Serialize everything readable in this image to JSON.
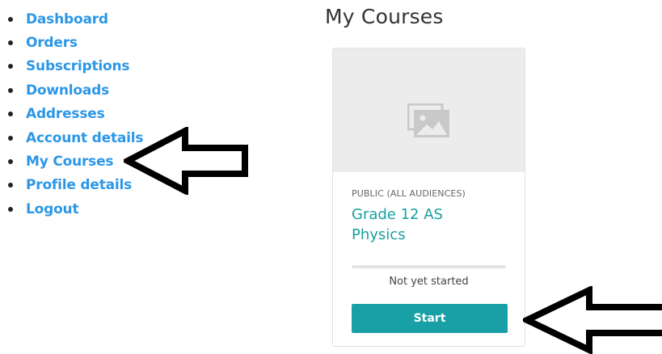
{
  "nav": {
    "items": [
      {
        "label": "Dashboard"
      },
      {
        "label": "Orders"
      },
      {
        "label": "Subscriptions"
      },
      {
        "label": "Downloads"
      },
      {
        "label": "Addresses"
      },
      {
        "label": "Account details"
      },
      {
        "label": "My Courses"
      },
      {
        "label": "Profile details"
      },
      {
        "label": "Logout"
      }
    ]
  },
  "page": {
    "title": "My Courses"
  },
  "course": {
    "access": "PUBLIC (ALL AUDIENCES)",
    "title": "Grade 12 AS Physics",
    "progress_percent": 0,
    "status": "Not yet started",
    "action_label": "Start",
    "thumbnail_icon": "image-placeholder-icon"
  },
  "colors": {
    "nav_link": "#2c97e6",
    "accent": "#18a0a6",
    "title": "#333333",
    "annotation_arrow": "#000000"
  },
  "annotations": {
    "arrow_icon": "left-arrow-icon"
  }
}
